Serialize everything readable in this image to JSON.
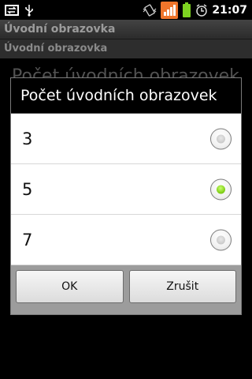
{
  "status_bar": {
    "time": "21:07",
    "left_icons": [
      "usb-sync-icon",
      "usb-icon"
    ],
    "right_icons": [
      "vibrate-icon",
      "signal-icon",
      "battery-icon",
      "alarm-icon"
    ]
  },
  "app": {
    "title": "Úvodní obrazovka",
    "category": "Úvodní obrazovka",
    "background_pref_title": "Počet úvodních obrazovek"
  },
  "dialog": {
    "title": "Počet úvodních obrazovek",
    "options": [
      {
        "label": "3",
        "checked": false
      },
      {
        "label": "5",
        "checked": true
      },
      {
        "label": "7",
        "checked": false
      }
    ],
    "ok_label": "OK",
    "cancel_label": "Zrušit"
  },
  "colors": {
    "radio_checked": "#84d21a",
    "signal_orange": "#f0752b",
    "battery_green": "#7ed321"
  }
}
